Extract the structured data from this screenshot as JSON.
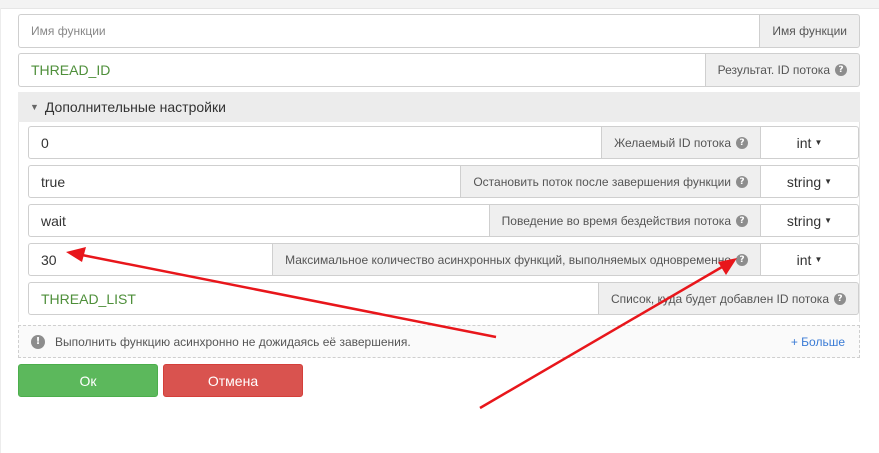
{
  "function_name": {
    "placeholder": "Имя функции",
    "label": "Имя функции"
  },
  "result_thread_id": {
    "value": "THREAD_ID",
    "label": "Результат. ID потока"
  },
  "section": {
    "title": "Дополнительные настройки"
  },
  "params": [
    {
      "value": "0",
      "label": "Желаемый ID потока",
      "type": "int"
    },
    {
      "value": "true",
      "label": "Остановить поток после завершения функции",
      "type": "string"
    },
    {
      "value": "wait",
      "label": "Поведение во время бездействия потока",
      "type": "string"
    },
    {
      "value": "30",
      "label": "Максимальное количество асинхронных функций, выполняемых одновременно",
      "type": "int"
    }
  ],
  "thread_list": {
    "value": "THREAD_LIST",
    "label": "Список, куда будет добавлен ID потока"
  },
  "info": {
    "text": "Выполнить функцию асинхронно не дожидаясь её завершения.",
    "more": "+ Больше"
  },
  "buttons": {
    "ok": "Ок",
    "cancel": "Отмена"
  },
  "colors": {
    "accent_green": "#5cb85c",
    "danger_red": "#d9534f",
    "annotation_arrow": "#e8161b",
    "value_green": "#4e8f3a"
  }
}
